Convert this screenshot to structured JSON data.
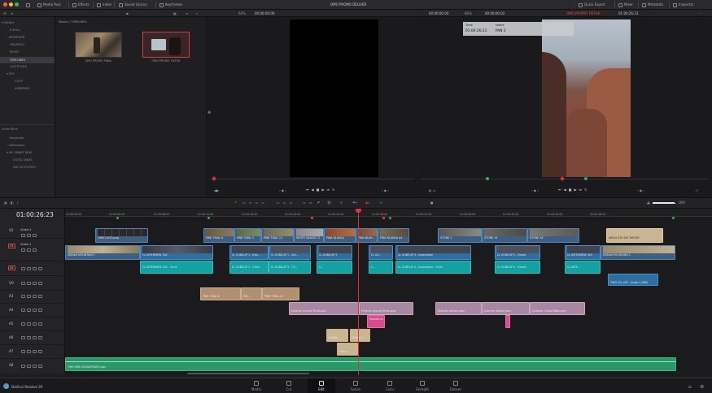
{
  "topbar": {
    "media_pool": "Media Pool",
    "effects": "Effects",
    "index": "Index",
    "sound_library": "Sound Library",
    "keyframes": "Keyframes",
    "project_title": "OMO PROMO DELIVER",
    "quick_export": "Quick Export",
    "mixer": "Mixer",
    "metadata": "Metadata",
    "inspector": "Inspector"
  },
  "viewer_bar": {
    "src_zoom": "60%",
    "src_tc": "00:00:00:00",
    "src_tc_right": "00:00:00:00",
    "prog_zoom": "60%",
    "prog_duration": "00:00:00:02",
    "timeline_name": "OMO PROMO TIKTOK",
    "prog_tc": "01:00:26:23"
  },
  "sidebar": {
    "items": [
      {
        "label": "Master",
        "indent": false
      },
      {
        "label": "B-ROLL",
        "indent": true
      },
      {
        "label": "INTERVIEW",
        "indent": true
      },
      {
        "label": "GRAPHICS",
        "indent": true
      },
      {
        "label": "MUSIC",
        "indent": true
      },
      {
        "label": "TIMELINES",
        "indent": true,
        "selected": true
      },
      {
        "label": "VOICEOVER",
        "indent": true
      },
      {
        "label": "SFX",
        "indent": true
      },
      {
        "label": "COZY",
        "indent": true
      },
      {
        "label": "AMBIENCE",
        "indent": true
      }
    ],
    "smart_bins": "Smart Bins",
    "smart_items": [
      "Keywords",
      "Collections",
      "MY SMART BINS",
      "GOOD TAKES",
      "DAY ACTIVITIES"
    ]
  },
  "pool": {
    "breadcrumb": "Master / TIMELINES",
    "thumbs": [
      "OMO PROMO FINAL",
      "OMO PROMO TIKTOK"
    ]
  },
  "overlay": {
    "time_label": "Time",
    "time_value": "01:00:26:23",
    "name_label": "Name",
    "name_value": "PAN 2"
  },
  "timeline": {
    "timecode": "01:00:26:23",
    "zoom_label": "DIM",
    "ruler": [
      "01:00:00:00",
      "01:00:04:00",
      "01:00:08:00",
      "01:00:12:00",
      "01:00:16:00",
      "01:00:20:00",
      "01:00:24:00",
      "01:00:28:00",
      "01:00:32:00",
      "01:00:36:00",
      "01:00:40:00",
      "01:00:44:00",
      "01:00:48:00"
    ],
    "tracks": [
      {
        "id": "V2",
        "name": "Video 2"
      },
      {
        "id": "V1",
        "name": "Video 1"
      },
      {
        "id": "A1",
        "name": ""
      },
      {
        "id": "VO",
        "name": ""
      },
      {
        "id": "A3",
        "name": ""
      },
      {
        "id": "A4",
        "name": ""
      },
      {
        "id": "A5",
        "name": ""
      },
      {
        "id": "A6",
        "name": ""
      },
      {
        "id": "A7",
        "name": ""
      },
      {
        "id": "A8",
        "name": ""
      }
    ],
    "clips": {
      "v2_logo": "OMO LOGO.png",
      "v2_pine1": "PINE TRAIL 6",
      "v2_pine2": "PINE TRAIL 5",
      "v2_pine3": "PINE TRAIL 12",
      "v2_white": "WHITE GAUGE 13",
      "v2_pb1": "PINA BLANCA",
      "v2_pb2": "PINA BLAN...",
      "v2_pb3": "PINA BLANCA a4",
      "v2_stone1": "STONE 2",
      "v2_stone2": "STONE 34",
      "v2_stone3": "STONE 28",
      "v2_tan": "ABSOLUTE SKY DRONE",
      "v1_sand": "DREAM MOUNTAIN 1",
      "v1_int": "CL INTERVIEW 7b2",
      "v1_c1": "CL SUBCLIP 1 - Exp...",
      "v1_c2": "CL SUBCLIP 1 - Sel...",
      "v1_c3": "CL SUBCLIP 3",
      "v1_c4": "CL SU...",
      "v1_c5": "CL SUBCLIP 4 - Inspiration",
      "v1_c6": "CL SUBCLIP 2 - Brand",
      "v1_c7": "CL INTERVIEW 7b3",
      "v1_dream": "DREAM MOUNTAIN 1",
      "a1_c1": "CL INTERVIEW 7b2 - Chris",
      "a1_c2": "CL SUBCLIP 1 - Chris",
      "a1_c3": "CL SUBCLIP 3 - Ch...",
      "a1_c4": "C...",
      "a1_c5": "C...",
      "a1_c6": "CL SUBCLIP 4 - Inspiration - Chris",
      "a1_c7": "CL SUBCLIP 2 - Brand -",
      "a1_c8": "CL INTE...",
      "vo_c1": "OMO VO_003 - Audio 1.WAV",
      "a3_c1": "PINE TRAIL 6",
      "a3_c2": "PIN...",
      "a3_c3": "PINE TRAIL 12",
      "a4_c1": "Exterior Almost Wind.wav",
      "a4_c2": "Exterior Almost Birds.wav",
      "a4_c3": "Exterior almost.wav",
      "a4_c4": "Exterior almost wav",
      "a4_c5": "Outdoor Crowd Walk.wav",
      "a5_c1": "Rooster.w...",
      "a5_c2": "Rooster.wav",
      "a6_c1": "Pebble",
      "a6_c2": "Pebble 2",
      "a7_c1": "Fabric",
      "a8_c1": "OMO MIN SOUNDTRACK.wav"
    }
  },
  "pages": [
    "Media",
    "Cut",
    "Edit",
    "Fusion",
    "Color",
    "Fairlight",
    "Deliver"
  ],
  "active_page": "Edit",
  "app_name": "DaVinci Resolve 20",
  "colors": {
    "video": "#3b5f85",
    "teal": "#13a1a3",
    "audio_tan": "#b09070",
    "audio_purple": "#a887a2",
    "audio_pink": "#d74b8f",
    "audio_green": "#2a9868",
    "playhead": "#e0303a"
  }
}
